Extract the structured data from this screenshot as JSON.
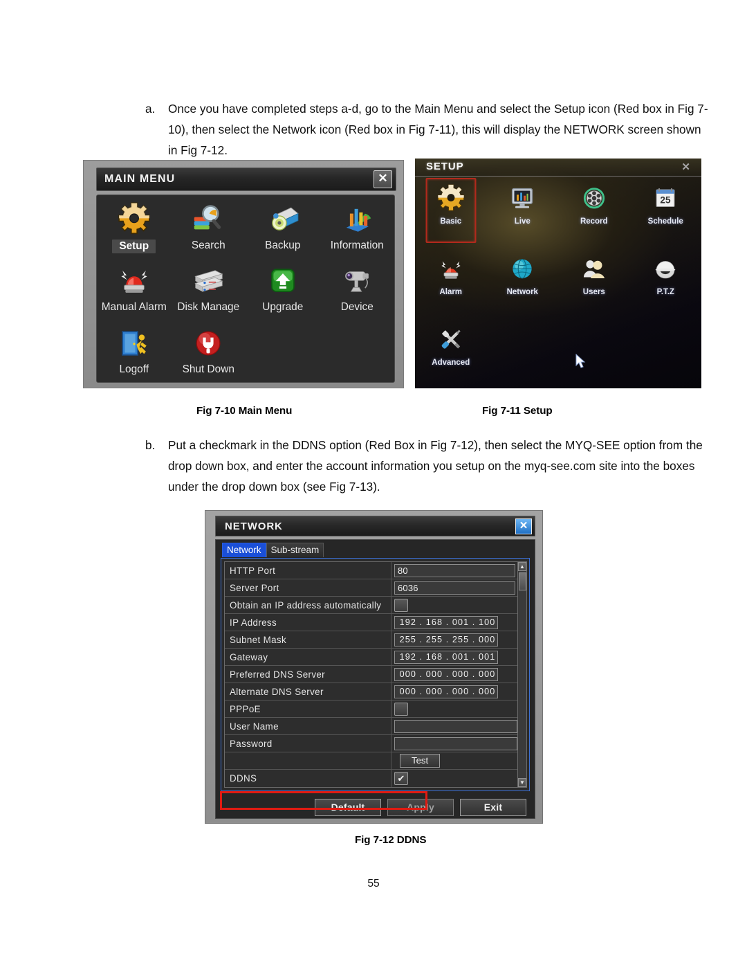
{
  "document": {
    "page_number": "55",
    "paragraphs": [
      {
        "marker": "a.",
        "text": "Once you have completed steps a-d, go to the Main Menu and select the Setup icon (Red box in Fig 7-10), then select the Network icon (Red box in Fig 7-11), this will display the NETWORK screen shown in Fig 7-12."
      },
      {
        "marker": "b.",
        "text": "Put a checkmark in the DDNS option (Red Box in Fig 7-12), then select the MYQ-SEE option from the drop down box, and enter the account information you setup on the myq-see.com site into the boxes under the drop down box (see Fig 7-13)."
      }
    ],
    "captions": {
      "fig_710": "Fig 7-10 Main Menu",
      "fig_711": "Fig 7-11 Setup",
      "fig_712": "Fig 7-12 DDNS"
    }
  },
  "main_menu": {
    "title": "MAIN MENU",
    "close_label": "✕",
    "items": [
      {
        "label": "Setup",
        "icon": "gear-icon",
        "selected": true
      },
      {
        "label": "Search",
        "icon": "magnifier-books-icon",
        "selected": false
      },
      {
        "label": "Backup",
        "icon": "disc-drive-icon",
        "selected": false
      },
      {
        "label": "Information",
        "icon": "bar-chart-icon",
        "selected": false
      },
      {
        "label": "Manual Alarm",
        "icon": "siren-icon",
        "selected": false
      },
      {
        "label": "Disk Manage",
        "icon": "hard-disks-icon",
        "selected": false
      },
      {
        "label": "Upgrade",
        "icon": "green-up-arrow-icon",
        "selected": false
      },
      {
        "label": "Device",
        "icon": "camera-icon",
        "selected": false
      },
      {
        "label": "Logoff",
        "icon": "exit-door-icon",
        "selected": false
      },
      {
        "label": "Shut Down",
        "icon": "power-plug-icon",
        "selected": false
      }
    ]
  },
  "setup_menu": {
    "title": "SETUP",
    "close_label": "✕",
    "items": [
      {
        "label": "Basic",
        "icon": "gear-icon",
        "highlighted": true
      },
      {
        "label": "Live",
        "icon": "monitor-chart-icon",
        "highlighted": false
      },
      {
        "label": "Record",
        "icon": "film-reel-icon",
        "highlighted": false
      },
      {
        "label": "Schedule",
        "icon": "calendar-25-icon",
        "highlighted": false
      },
      {
        "label": "Alarm",
        "icon": "siren-icon",
        "highlighted": false
      },
      {
        "label": "Network",
        "icon": "globe-icon",
        "highlighted": false
      },
      {
        "label": "Users",
        "icon": "users-icon",
        "highlighted": false
      },
      {
        "label": "P.T.Z",
        "icon": "dome-camera-icon",
        "highlighted": false
      },
      {
        "label": "Advanced",
        "icon": "wrench-screwdriver-icon",
        "highlighted": false
      }
    ],
    "calendar_day": "25",
    "highlight_color": "#b2291c",
    "cursor": "mouse-pointer"
  },
  "network_dialog": {
    "title": "NETWORK",
    "close_label": "✕",
    "tabs": [
      {
        "label": "Network",
        "active": true
      },
      {
        "label": "Sub-stream",
        "active": false
      }
    ],
    "rows": [
      {
        "label": "HTTP Port",
        "type": "text",
        "value": "80"
      },
      {
        "label": "Server Port",
        "type": "text",
        "value": "6036"
      },
      {
        "label": "Obtain an IP address automatically",
        "type": "checkbox",
        "checked": false
      },
      {
        "label": "IP Address",
        "type": "ip",
        "value": "192 . 168 . 001 . 100"
      },
      {
        "label": "Subnet Mask",
        "type": "ip",
        "value": "255 . 255 . 255 . 000"
      },
      {
        "label": "Gateway",
        "type": "ip",
        "value": "192 . 168 . 001 . 001"
      },
      {
        "label": "Preferred DNS Server",
        "type": "ip",
        "value": "000 . 000 . 000 . 000"
      },
      {
        "label": "Alternate DNS Server",
        "type": "ip",
        "value": "000 . 000 . 000 . 000"
      },
      {
        "label": "PPPoE",
        "type": "checkbox",
        "checked": false
      },
      {
        "label": "User Name",
        "type": "text",
        "value": ""
      },
      {
        "label": "Password",
        "type": "text",
        "value": ""
      },
      {
        "label": "",
        "type": "button",
        "value": "Test"
      },
      {
        "label": "DDNS",
        "type": "checkbox",
        "checked": true
      }
    ],
    "buttons": [
      {
        "label": "Default",
        "dim": false
      },
      {
        "label": "Apply",
        "dim": true
      },
      {
        "label": "Exit",
        "dim": false
      }
    ],
    "scrollbar": {
      "up": "▲",
      "down": "▼"
    },
    "highlight_color": "#e01b12"
  }
}
